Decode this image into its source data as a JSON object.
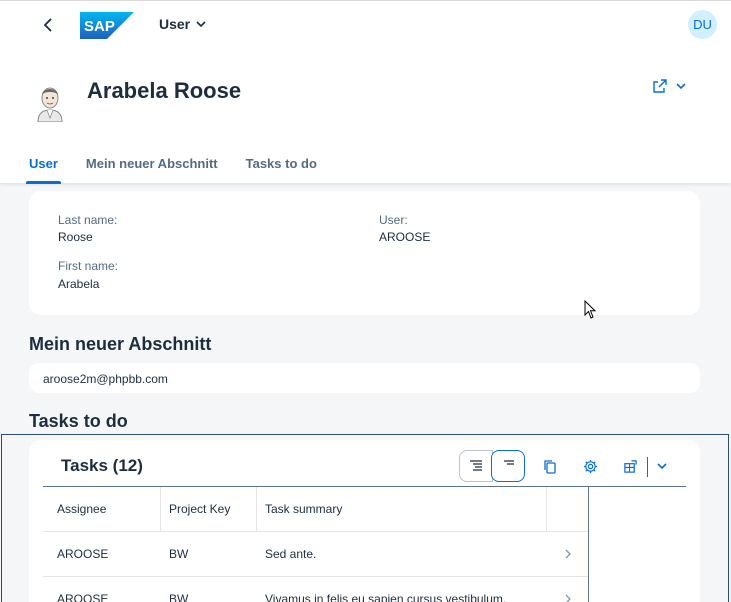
{
  "shellbar": {
    "app_title": "User",
    "avatar_initials": "DU",
    "logo_text": "SAP"
  },
  "header": {
    "user_name": "Arabela Roose"
  },
  "tabs": [
    {
      "label": "User",
      "active": true
    },
    {
      "label": "Mein neuer Abschnitt",
      "active": false
    },
    {
      "label": "Tasks to do",
      "active": false
    }
  ],
  "user_section": {
    "last_name_label": "Last name:",
    "last_name_value": "Roose",
    "user_label": "User:",
    "user_value": "AROOSE",
    "first_name_label": "First name:",
    "first_name_value": "Arabela"
  },
  "section2": {
    "title": "Mein neuer Abschnitt",
    "email": "aroose2m@phpbb.com"
  },
  "section3": {
    "title": "Tasks to do",
    "table_title": "Tasks (12)",
    "columns": [
      "Assignee",
      "Project Key",
      "Task summary"
    ],
    "rows": [
      {
        "assignee": "AROOSE",
        "project_key": "BW",
        "summary": "Sed ante."
      },
      {
        "assignee": "AROOSE",
        "project_key": "BW",
        "summary": "Vivamus in felis eu sapien cursus vestibulum."
      }
    ]
  },
  "colors": {
    "accent": "#0a6ed1",
    "text": "#1d2d3e",
    "background": "#f5f6f7"
  }
}
